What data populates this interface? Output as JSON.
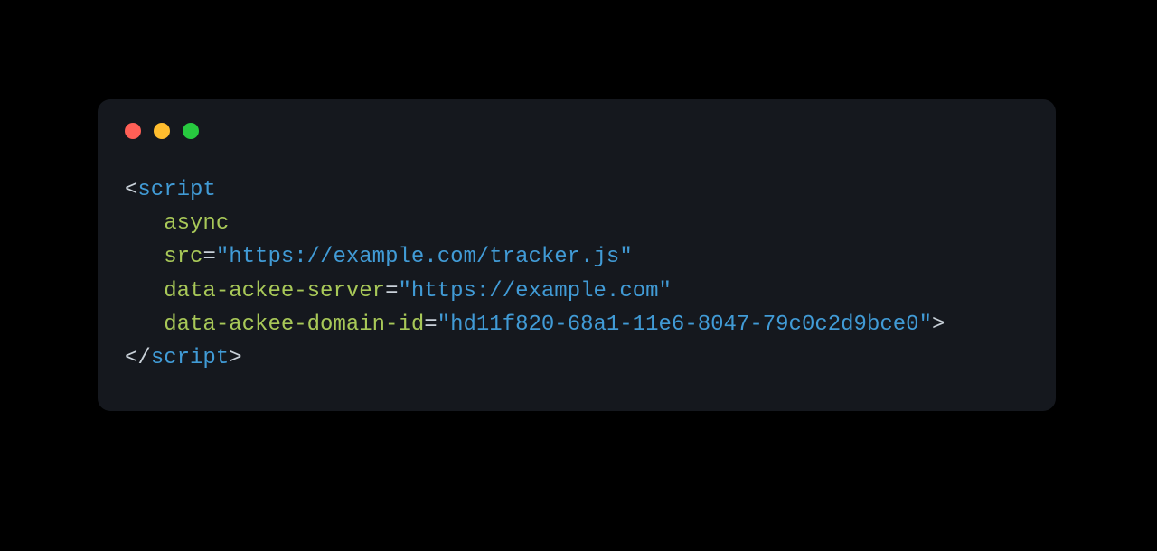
{
  "traffic": {
    "red": "close",
    "yellow": "minimize",
    "green": "zoom"
  },
  "code": {
    "indent": "   ",
    "open": {
      "lt": "<",
      "tag": "script"
    },
    "attrs": {
      "async": "async",
      "src": {
        "name": "src",
        "eq": "=",
        "q1": "\"",
        "value": "https://example.com/tracker.js",
        "q2": "\""
      },
      "server": {
        "name": "data-ackee-server",
        "eq": "=",
        "q1": "\"",
        "value": "https://example.com",
        "q2": "\""
      },
      "domain": {
        "name": "data-ackee-domain-id",
        "eq": "=",
        "q1": "\"",
        "value": "hd11f820-68a1-11e6-8047-79c0c2d9bce0",
        "q2": "\"",
        "gt": ">"
      }
    },
    "close": {
      "lt": "<",
      "slash": "/",
      "tag": "script",
      "gt": ">"
    }
  }
}
